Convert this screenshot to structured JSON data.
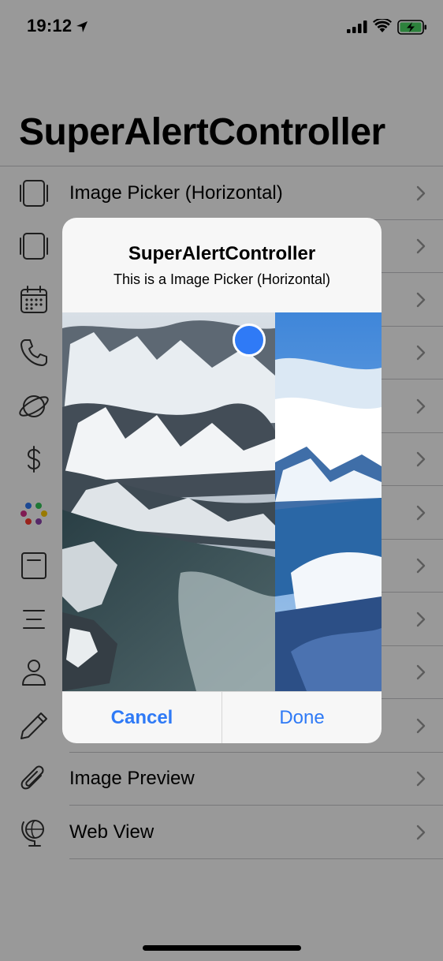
{
  "status_bar": {
    "time": "19:12"
  },
  "title": "SuperAlertController",
  "list": {
    "items": [
      {
        "label": "Image Picker (Horizontal)",
        "icon": "square-stack-icon"
      },
      {
        "label": "",
        "icon": "square-stack-icon"
      },
      {
        "label": "",
        "icon": "calendar-icon"
      },
      {
        "label": "",
        "icon": "phone-icon"
      },
      {
        "label": "",
        "icon": "planet-icon"
      },
      {
        "label": "",
        "icon": "dollar-icon"
      },
      {
        "label": "",
        "icon": "color-dots-icon"
      },
      {
        "label": "",
        "icon": "note-icon"
      },
      {
        "label": "",
        "icon": "text-lines-icon"
      },
      {
        "label": "",
        "icon": "person-icon"
      },
      {
        "label": "",
        "icon": "pencil-icon"
      },
      {
        "label": "Image Preview",
        "icon": "paperclip-icon"
      },
      {
        "label": "Web View",
        "icon": "globe-icon"
      }
    ]
  },
  "alert": {
    "title": "SuperAlertController",
    "message": "This is a Image Picker (Horizontal)",
    "cancel_label": "Cancel",
    "done_label": "Done"
  },
  "colors": {
    "accent": "#2f7af6",
    "overlay": "rgba(0,0,0,0.40)",
    "alert_background": "#f7f7f7"
  }
}
